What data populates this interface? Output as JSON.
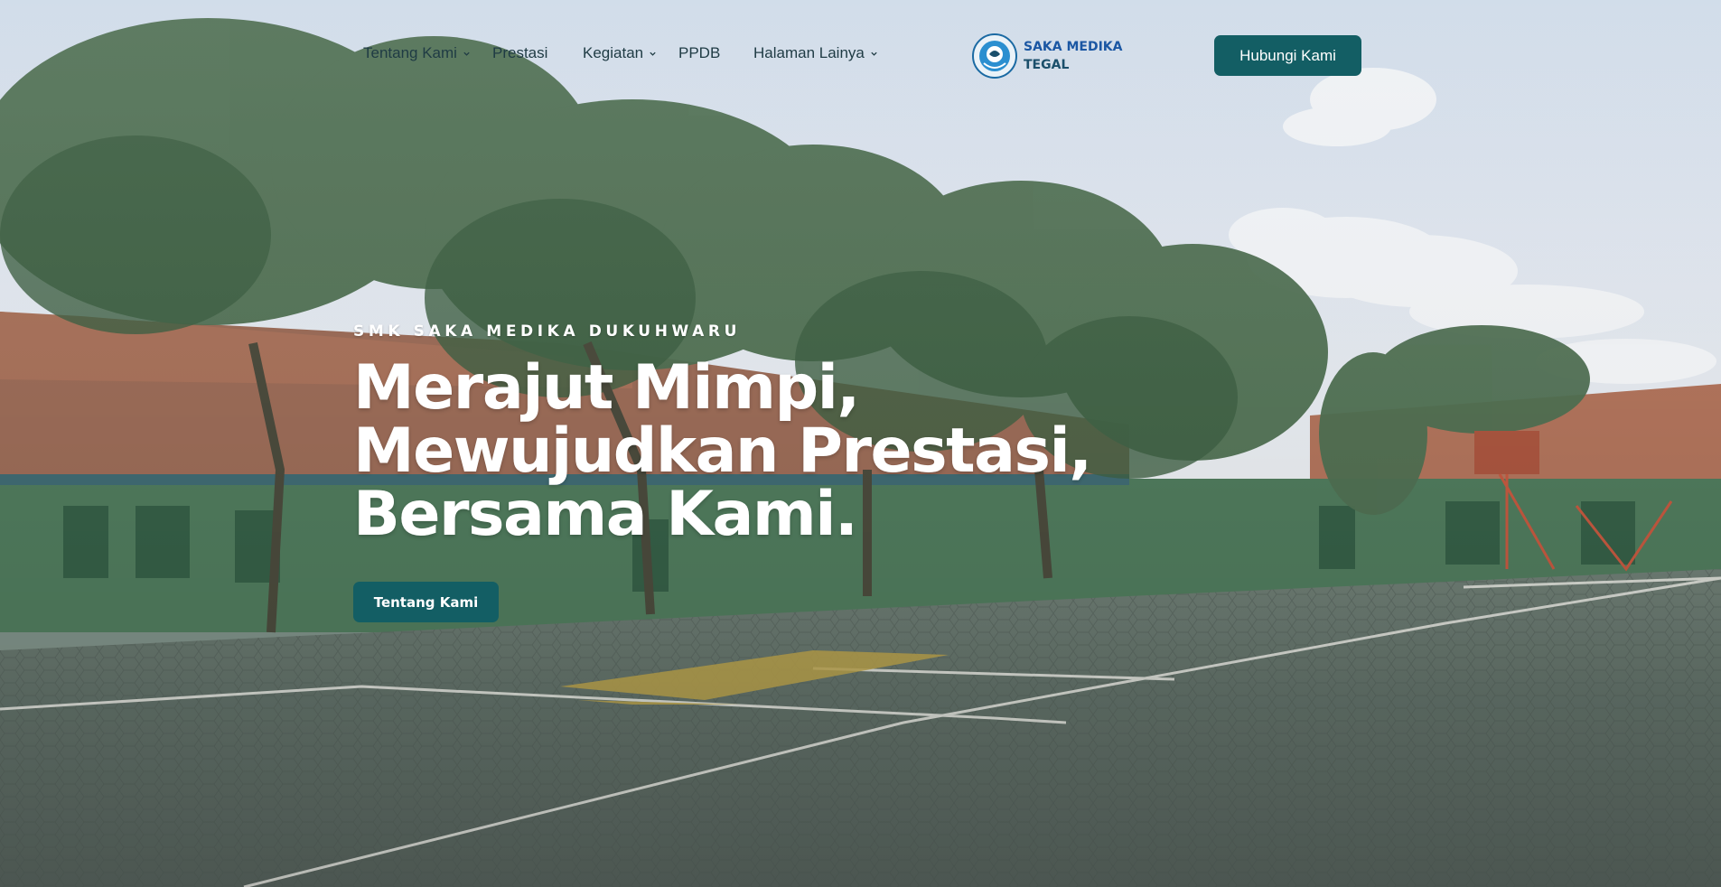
{
  "nav": {
    "items": [
      {
        "label": "Tentang Kami",
        "has_dropdown": true
      },
      {
        "label": "Prestasi",
        "has_dropdown": false
      },
      {
        "label": "Kegiatan",
        "has_dropdown": true
      },
      {
        "label": "PPDB",
        "has_dropdown": false
      },
      {
        "label": "Halaman Lainya",
        "has_dropdown": true
      }
    ],
    "brand": {
      "line1": "SAKA MEDIKA",
      "line2": "TEGAL"
    },
    "cta_label": "Hubungi Kami"
  },
  "hero": {
    "eyebrow": "SMK SAKA MEDIKA DUKUHWARU",
    "headline_lines": [
      "Merajut Mimpi,",
      "Mewujudkan Prestasi,",
      "Bersama Kami."
    ],
    "button_label": "Tentang Kami"
  },
  "colors": {
    "accent": "#135e64",
    "nav_text": "#1f3b44",
    "brand_blue": "#1b57a3"
  },
  "icons": [
    "chevron-down-icon",
    "school-logo-icon"
  ]
}
